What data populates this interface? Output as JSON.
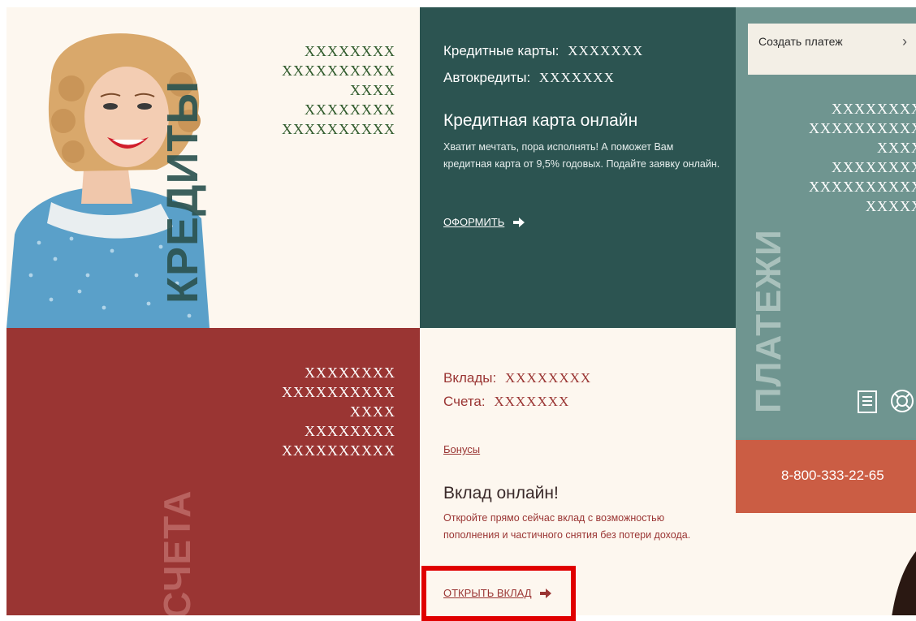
{
  "credits": {
    "vertical_label": "КРЕДИТЫ",
    "placeholder_lines": [
      "XXXXXXXX",
      "XXXXXXXXXX",
      "XXXX",
      "XXXXXXXX",
      "XXXXXXXXXX"
    ]
  },
  "cards": {
    "credit_cards_label": "Кредитные карты:",
    "credit_cards_value": "XXXXXXX",
    "auto_loans_label": "Автокредиты:",
    "auto_loans_value": "XXXXXXX",
    "promo_title": "Кредитная карта онлайн",
    "promo_text": "Хватит мечтать, пора исполнять! А поможет Вам кредитная карта от 9,5% годовых. Подайте заявку онлайн.",
    "cta_label": "ОФОРМИТЬ"
  },
  "payments": {
    "create_payment_label": "Создать платеж",
    "chevron": "›",
    "vertical_label": "ПЛАТЕЖИ",
    "placeholder_lines": [
      "XXXXXXXX",
      "XXXXXXXXXX",
      "XXXX",
      "XXXXXXXX",
      "XXXXXXXXXX",
      "XXXXX"
    ],
    "icons": [
      "list-icon",
      "support-icon"
    ]
  },
  "phone": {
    "number": "8-800-333-22-65"
  },
  "accounts": {
    "vertical_label": "СЧЕТА",
    "placeholder_lines": [
      "XXXXXXXX",
      "XXXXXXXXXX",
      "XXXX",
      "XXXXXXXX",
      "XXXXXXXXXX"
    ]
  },
  "deposits": {
    "deposits_label": "Вклады:",
    "deposits_value": "XXXXXXXX",
    "accounts_label": "Счета:",
    "accounts_value": "XXXXXXX",
    "bonuses_link": "Бонусы",
    "promo_title": "Вклад онлайн!",
    "promo_text": "Откройте прямо сейчас вклад с возможностью пополнения и частичного снятия без потери дохода.",
    "cta_label": "ОТКРЫТЬ ВКЛАД"
  },
  "colors": {
    "cream": "#fdf7ef",
    "dark_teal": "#2c5451",
    "sage": "#6f9590",
    "coral": "#cb5d44",
    "brick": "#9a3533",
    "green_text": "#2f5a2b",
    "highlight": "#e00000"
  }
}
